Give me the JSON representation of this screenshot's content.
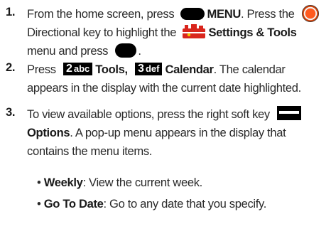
{
  "steps": [
    {
      "number": "1.",
      "l1_a": "From the home screen, press",
      "l1_b": "MENU",
      "l1_c": ". Press the",
      "l2_a": "Directional key to highlight the",
      "l2_b": "Settings & Tools",
      "l3_a": "menu and press",
      "l3_b": "."
    },
    {
      "number": "2.",
      "l1_a": "Press",
      "key2_digit": "2",
      "key2_letters": "abc",
      "l1_b": "Tools,",
      "key3_digit": "3",
      "key3_letters": "def",
      "l1_c": "Calendar",
      "l1_d": ". The calendar",
      "l2": "appears in the display with the current date highlighted."
    },
    {
      "number": "3.",
      "l1_a": "To view available options, press the right soft key",
      "l2_a": "Options",
      "l2_b": ". A pop-up menu appears in the display that",
      "l3": "contains the menu items."
    }
  ],
  "bullets": [
    {
      "term": "Weekly",
      "desc": ": View the current week."
    },
    {
      "term": "Go To Date",
      "desc": ": Go to any date that you specify."
    }
  ],
  "icons": {
    "menu_key": "soft-key-icon",
    "directional_key": "directional-key-icon",
    "settings_tools": "settings-tools-icon",
    "ok_key": "ok-key-icon",
    "right_soft_key": "right-soft-key-icon"
  },
  "colors": {
    "text": "#2a2a2a",
    "key_black": "#000000",
    "accent_orange": "#e8521c",
    "toolbox_red": "#d9251c"
  }
}
